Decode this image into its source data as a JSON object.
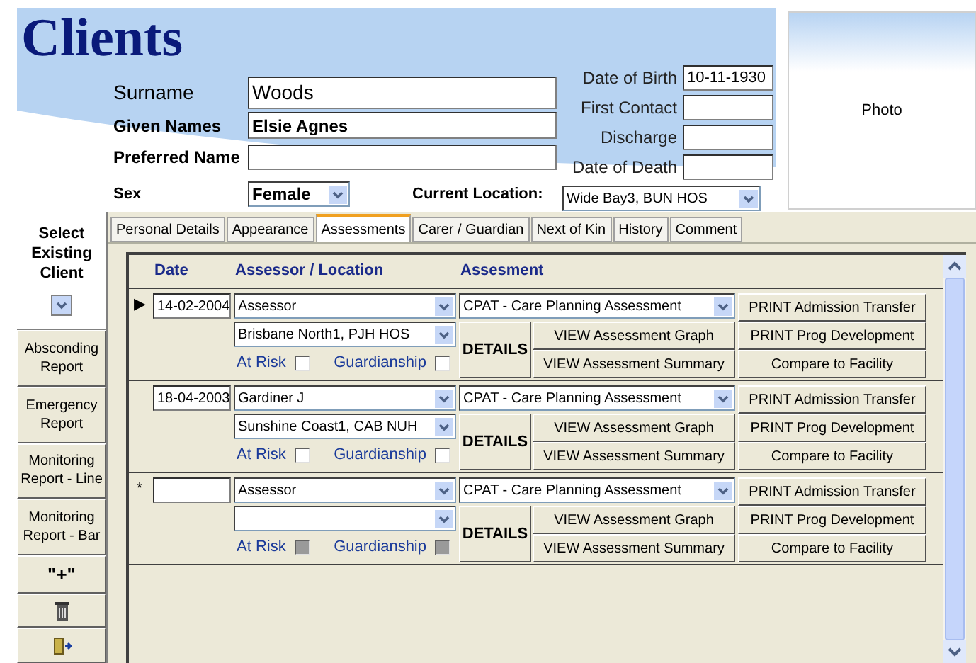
{
  "title": "Clients",
  "person": {
    "fields": [
      {
        "label": "Surname",
        "value": "Woods"
      },
      {
        "label": "Given Names",
        "value": "Elsie Agnes"
      },
      {
        "label": "Preferred Name"
      }
    ],
    "sex": {
      "label": "Sex",
      "value": "Female"
    },
    "dates": [
      {
        "label": "Date of Birth",
        "value": "10-11-1930"
      },
      {
        "label": "First Contact"
      },
      {
        "label": "Discharge"
      },
      {
        "label": "Date of Death"
      }
    ],
    "current_location": {
      "label": "Current Location:",
      "value": "Wide Bay3, BUN HOS"
    }
  },
  "photo": {
    "label": "Photo"
  },
  "sidebar": [
    {
      "kind": "header",
      "label": "Select Existing Client"
    },
    {
      "kind": "dropdown"
    },
    {
      "kind": "button",
      "label": "Absconding Report"
    },
    {
      "kind": "button",
      "label": "Emergency Report"
    },
    {
      "kind": "button",
      "label": "Monitoring Report - Line"
    },
    {
      "kind": "button",
      "label": "Monitoring Report - Bar"
    },
    {
      "kind": "button",
      "label": "\"+\""
    },
    {
      "kind": "delete"
    },
    {
      "kind": "exit"
    }
  ],
  "tabs": [
    {
      "label": "Personal Details",
      "selected": false
    },
    {
      "label": "Appearance",
      "selected": false
    },
    {
      "label": "Assessments",
      "selected": true
    },
    {
      "label": "Carer / Guardian",
      "selected": false
    },
    {
      "label": "Next of Kin",
      "selected": false
    },
    {
      "label": "History",
      "selected": false
    },
    {
      "label": "Comment",
      "selected": false
    }
  ],
  "assessments": {
    "columns": [
      "Date",
      "Assessor / Location",
      "Assesment"
    ],
    "rows": [
      {
        "marker": "▶",
        "date": "14-02-2004",
        "assessor": "Assessor",
        "location": "Brisbane North1, PJH HOS",
        "at_risk": {
          "label": "At Risk",
          "checked": false,
          "disabled": false
        },
        "guardianship": {
          "label": "Guardianship",
          "checked": false,
          "disabled": false
        },
        "assessment": "CPAT - Care Planning Assessment",
        "details": "DETAILS",
        "view_buttons": [
          "VIEW Assessment Graph",
          "VIEW Assessment Summary"
        ],
        "print_buttons": [
          "PRINT Admission Transfer",
          "PRINT Prog Development",
          "Compare to Facility"
        ]
      },
      {
        "date": "18-04-2003",
        "assessor": "Gardiner J",
        "location": "Sunshine Coast1, CAB NUH",
        "at_risk": {
          "label": "At Risk",
          "checked": false,
          "disabled": false
        },
        "guardianship": {
          "label": "Guardianship",
          "checked": false,
          "disabled": false
        },
        "assessment": "CPAT - Care Planning Assessment",
        "details": "DETAILS",
        "view_buttons": [
          "VIEW Assessment Graph",
          "VIEW Assessment Summary"
        ],
        "print_buttons": [
          "PRINT Admission Transfer",
          "PRINT Prog Development",
          "Compare to Facility"
        ]
      },
      {
        "marker": "*",
        "assessor": "Assessor",
        "at_risk": {
          "label": "At Risk",
          "checked": false,
          "disabled": true
        },
        "guardianship": {
          "label": "Guardianship",
          "checked": false,
          "disabled": true
        },
        "assessment": "CPAT - Care Planning Assessment",
        "details": "DETAILS",
        "view_buttons": [
          "VIEW Assessment Graph",
          "VIEW Assessment Summary"
        ],
        "print_buttons": [
          "PRINT Admission Transfer",
          "PRINT Prog Development",
          "Compare to Facility"
        ]
      }
    ]
  }
}
